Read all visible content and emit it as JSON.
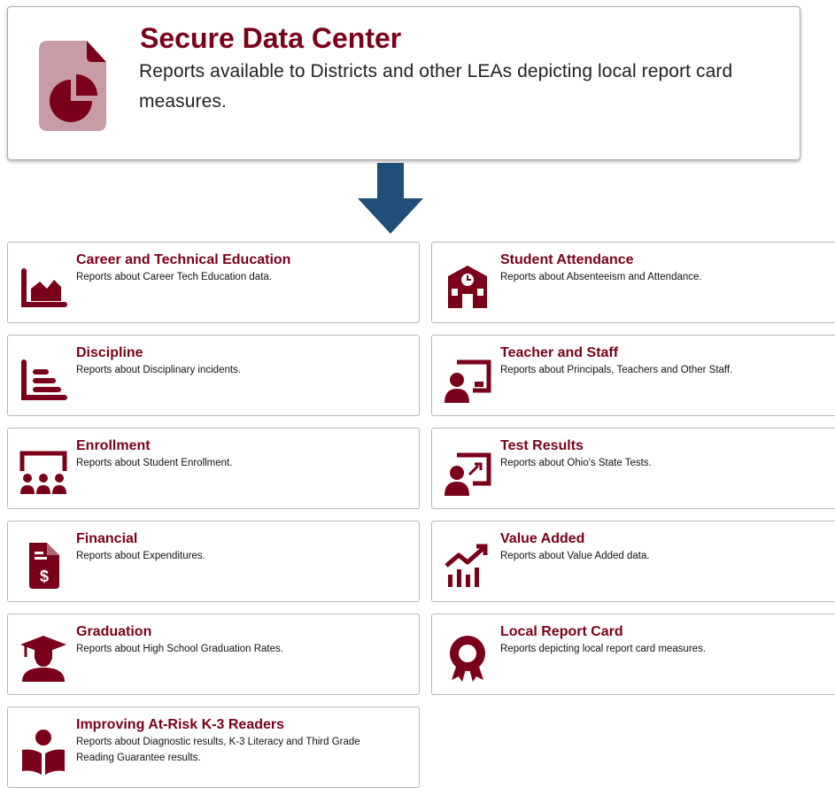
{
  "header": {
    "title": "Secure Data Center",
    "description": "Reports available to Districts and other LEAs depicting local report card measures.",
    "icon": "pie-chart-document-icon"
  },
  "arrow": {
    "icon": "arrow-down-icon",
    "color": "#1f4e79"
  },
  "colors": {
    "accent": "#7a0019",
    "arrow": "#1f4e79"
  },
  "reports": [
    {
      "name": "career-tech",
      "title": "Career and Technical Education",
      "description": "Reports about Career Tech Education data.",
      "icon": "area-chart-icon"
    },
    {
      "name": "student-attendance",
      "title": "Student Attendance",
      "description": "Reports about Absenteeism and Attendance.",
      "icon": "school-building-icon"
    },
    {
      "name": "discipline",
      "title": "Discipline",
      "description": "Reports about Disciplinary incidents.",
      "icon": "bar-chart-icon"
    },
    {
      "name": "teacher-staff",
      "title": "Teacher and Staff",
      "description": "Reports about Principals, Teachers and Other Staff.",
      "icon": "teacher-board-icon"
    },
    {
      "name": "enrollment",
      "title": "Enrollment",
      "description": "Reports about Student Enrollment.",
      "icon": "classroom-icon"
    },
    {
      "name": "test-results",
      "title": "Test Results",
      "description": "Reports about Ohio's State Tests.",
      "icon": "presentation-chart-icon"
    },
    {
      "name": "financial",
      "title": "Financial",
      "description": "Reports about Expenditures.",
      "icon": "dollar-document-icon"
    },
    {
      "name": "value-added",
      "title": "Value Added",
      "description": "Reports about Value Added data.",
      "icon": "growth-chart-icon"
    },
    {
      "name": "graduation",
      "title": "Graduation",
      "description": "Reports about High School Graduation Rates.",
      "icon": "graduate-icon"
    },
    {
      "name": "local-report-card",
      "title": "Local Report Card",
      "description": "Reports depicting local report card measures.",
      "icon": "award-badge-icon"
    },
    {
      "name": "k3-readers",
      "title": "Improving At-Risk K-3 Readers",
      "description": "Reports about Diagnostic results, K-3 Literacy and Third Grade Reading Guarantee results.",
      "icon": "reading-icon"
    }
  ]
}
